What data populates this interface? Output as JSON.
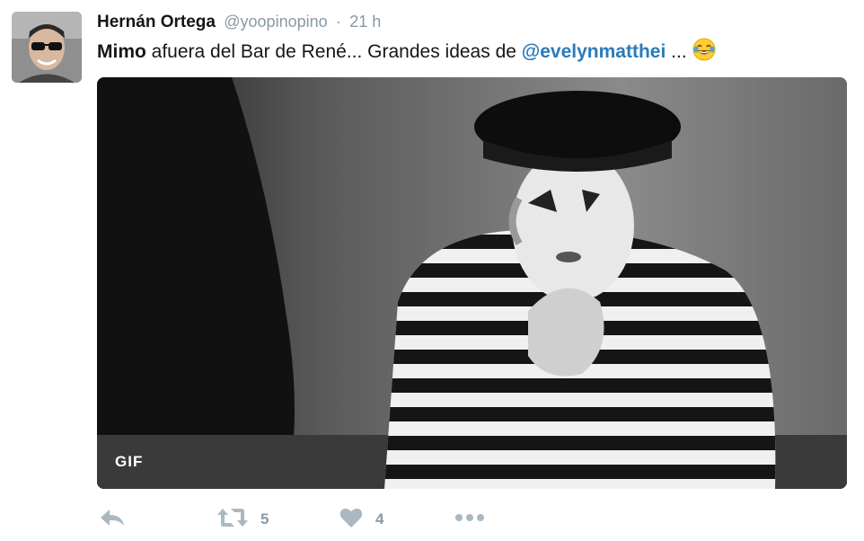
{
  "author": {
    "name": "Hernán Ortega",
    "handle": "@yoopinopino",
    "separator": "·",
    "time": "21 h"
  },
  "tweet": {
    "bold_word": "Mimo",
    "text_middle": " afuera del Bar de René... Grandes ideas de ",
    "mention": "@evelynmatthei",
    "text_end": " ...",
    "emoji": "face-with-tears-of-joy"
  },
  "media": {
    "badge": "GIF"
  },
  "actions": {
    "reply_icon": "reply-icon",
    "retweet_icon": "retweet-icon",
    "retweet_count": "5",
    "like_icon": "heart-icon",
    "like_count": "4",
    "more_icon": "more-icon"
  },
  "colors": {
    "text": "#14171a",
    "muted": "#8899a6",
    "icon": "#aab8c2",
    "mention": "#2b7bb9"
  }
}
